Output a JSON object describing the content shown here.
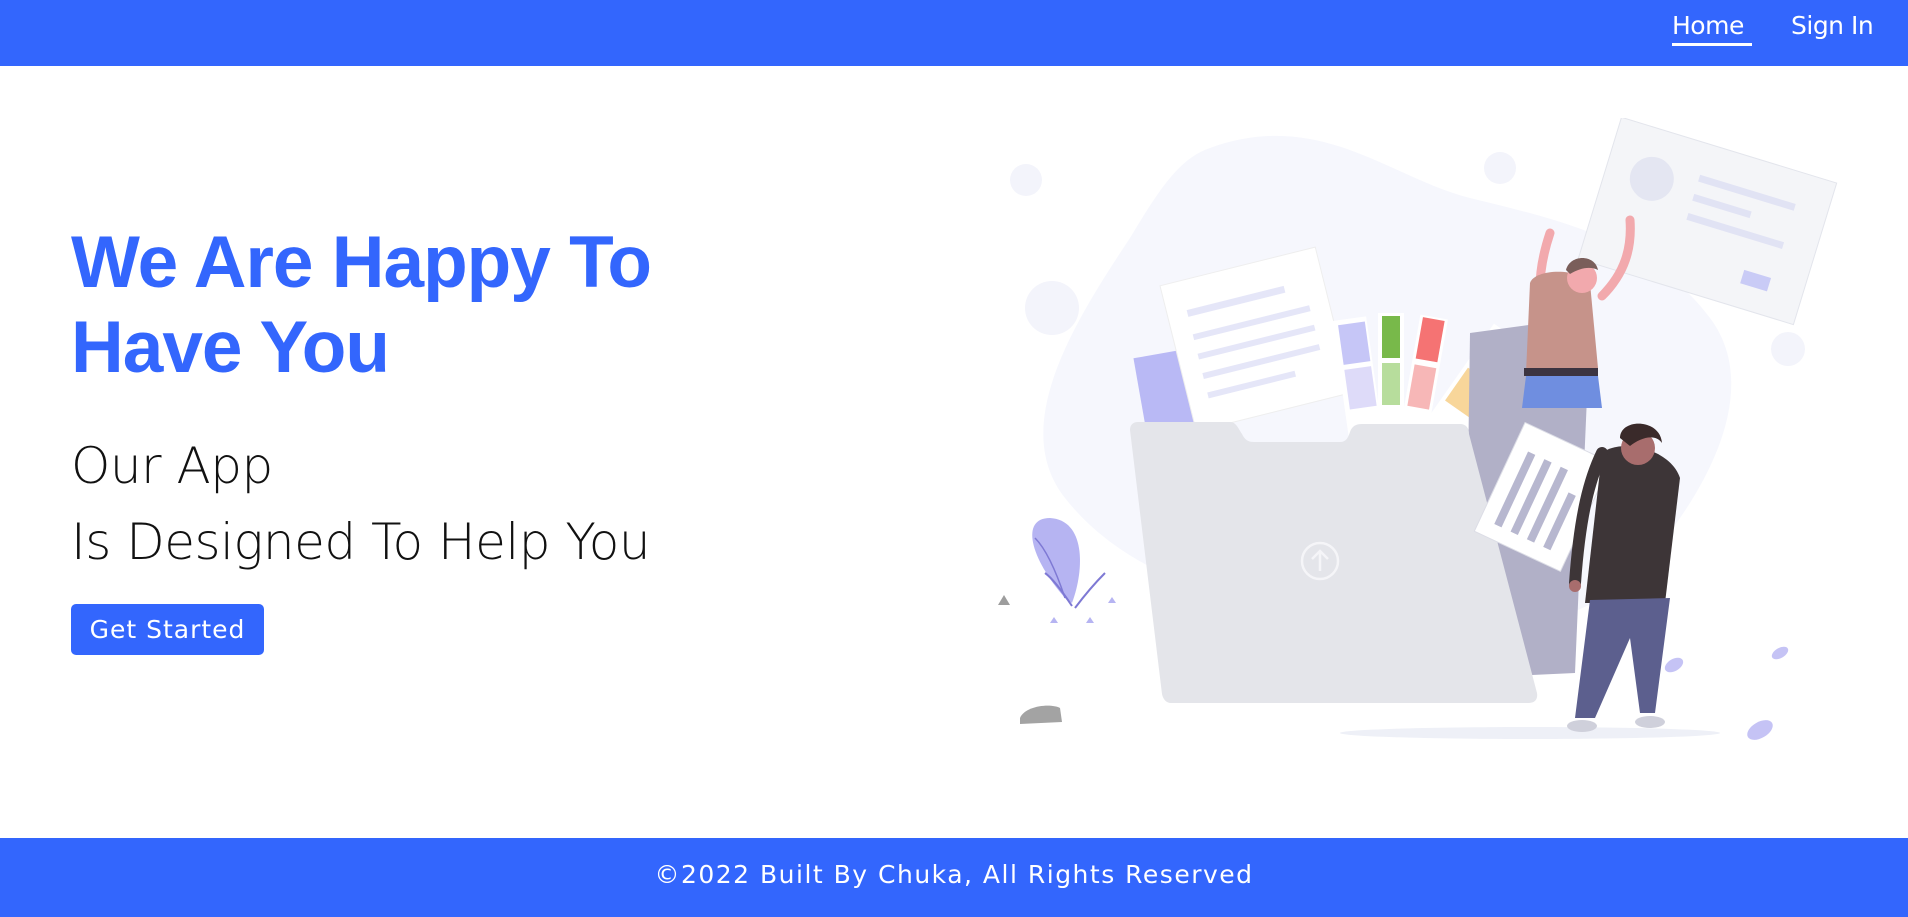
{
  "nav": {
    "home_label": "Home",
    "signin_label": "Sign In"
  },
  "hero": {
    "title": "We Are Happy To Have You",
    "subtitle_line1": "Our App",
    "subtitle_line2": "Is Designed To Help You",
    "cta_label": "Get Started"
  },
  "footer": {
    "text": "©2022 Built By Chuka, All Rights Reserved"
  },
  "colors": {
    "brand": "#3366fd",
    "text_dark": "#111111",
    "background": "#ffffff"
  },
  "icons": {
    "illustration": "file-upload-illustration",
    "upload": "arrow-up-circle-icon"
  }
}
